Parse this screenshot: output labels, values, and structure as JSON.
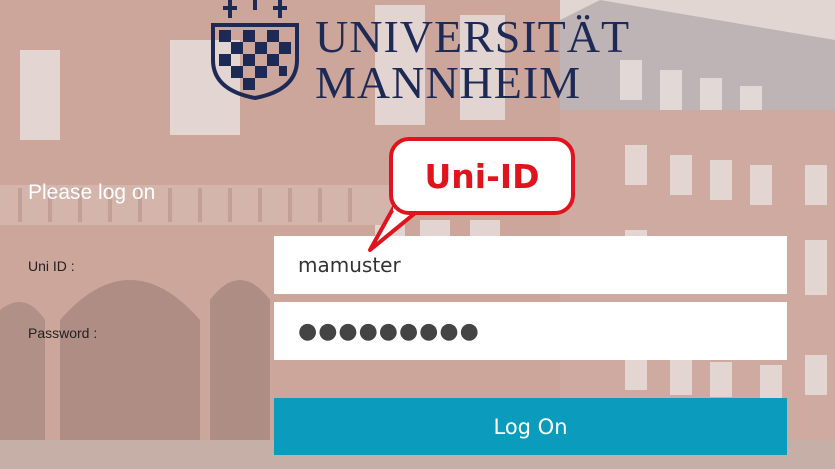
{
  "logo": {
    "line1": "UNIVERSITÄT",
    "line2": "MANNHEIM"
  },
  "login": {
    "heading": "Please log on",
    "uid_label": "Uni ID :",
    "uid_value": "mamuster",
    "password_label": "Password :",
    "password_value": "●●●●●●●●●",
    "submit_label": "Log On"
  },
  "callout": {
    "text": "Uni-ID"
  },
  "colors": {
    "brand_navy": "#1d2a55",
    "button": "#0b9bbd",
    "callout_red": "#e0141c"
  }
}
